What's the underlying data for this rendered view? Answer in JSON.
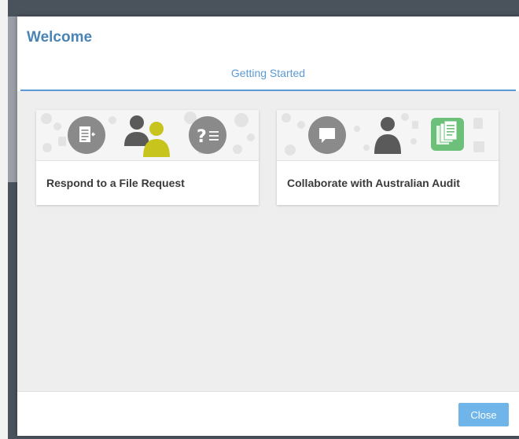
{
  "dialog": {
    "title": "Welcome",
    "tabs": [
      {
        "label": "Getting Started",
        "active": true
      }
    ]
  },
  "cards": [
    {
      "label": "Respond to a File Request",
      "icons": [
        "document-arrow-icon",
        "people-icon",
        "question-list-icon"
      ]
    },
    {
      "label": "Collaborate with Australian Audit",
      "icons": [
        "chat-bubble-icon",
        "person-icon",
        "documents-stack-icon"
      ]
    }
  ],
  "footer": {
    "close_label": "Close"
  },
  "colors": {
    "accent": "#5b9bd5",
    "title": "#4a84b5",
    "button": "#6fb5e9",
    "yellow_person": "#c7c41d",
    "green_docs": "#6cc07a"
  }
}
